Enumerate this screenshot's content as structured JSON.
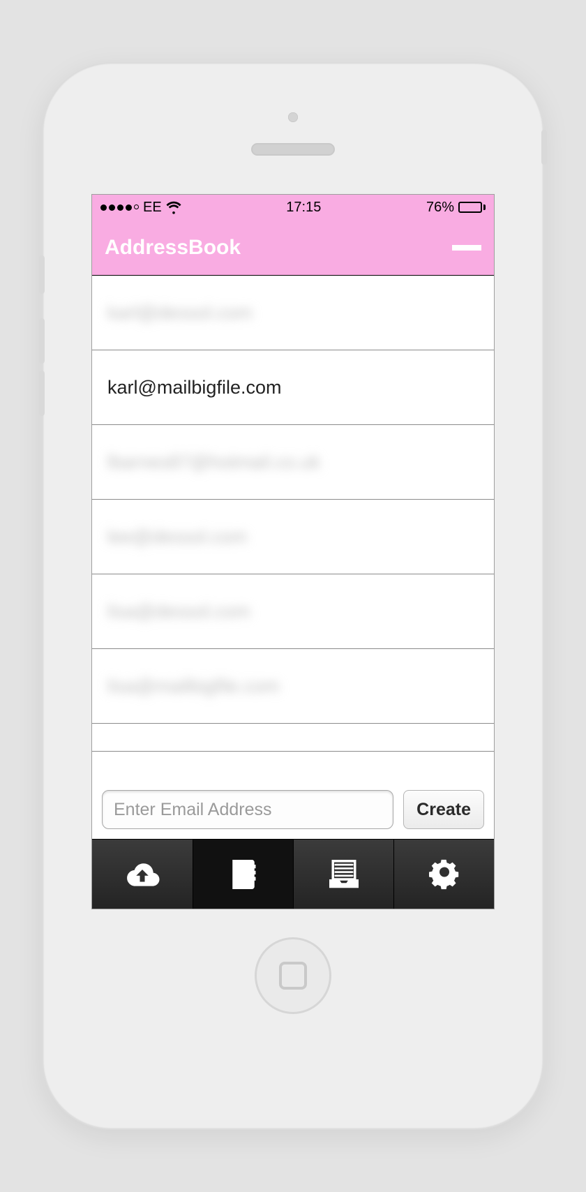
{
  "status": {
    "carrier": "EE",
    "time": "17:15",
    "battery_pct": "76%"
  },
  "header": {
    "title": "AddressBook"
  },
  "contacts": [
    {
      "email": "karl@dessol.com",
      "blurred": true
    },
    {
      "email": "karl@mailbigfile.com",
      "blurred": false
    },
    {
      "email": "lbarnes87@hotmail.co.uk",
      "blurred": true
    },
    {
      "email": "lee@dessol.com",
      "blurred": true
    },
    {
      "email": "lisa@dessol.com",
      "blurred": true
    },
    {
      "email": "lisa@mailbigfile.com",
      "blurred": true
    }
  ],
  "add_form": {
    "placeholder": "Enter Email Address",
    "create_label": "Create"
  },
  "tabs": {
    "upload": "upload-icon",
    "contacts": "contacts-icon",
    "inbox": "inbox-icon",
    "settings": "settings-icon",
    "active": "contacts"
  }
}
